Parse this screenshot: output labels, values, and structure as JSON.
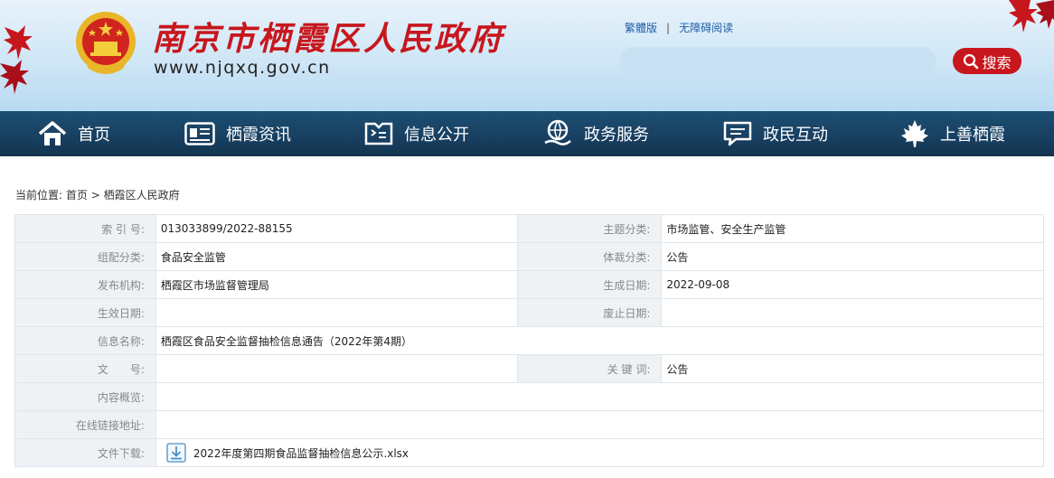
{
  "header": {
    "site_title": "南京市栖霞区人民政府",
    "site_url": "www.njqxq.gov.cn",
    "traditional_link": "繁體版",
    "separator": "|",
    "accessible_link": "无障碍阅读",
    "search_placeholder": "",
    "search_button": "搜索"
  },
  "nav": [
    {
      "label": "首页",
      "icon": "home-icon"
    },
    {
      "label": "栖霞资讯",
      "icon": "news-icon"
    },
    {
      "label": "信息公开",
      "icon": "document-icon"
    },
    {
      "label": "政务服务",
      "icon": "service-icon"
    },
    {
      "label": "政民互动",
      "icon": "chat-icon"
    },
    {
      "label": "上善栖霞",
      "icon": "maple-leaf-icon"
    }
  ],
  "breadcrumb": {
    "prefix": "当前位置:",
    "home": "首页",
    "sep": ">",
    "current": "栖霞区人民政府"
  },
  "info": {
    "index_label": "索 引 号:",
    "index_value": "013033899/2022-88155",
    "topic_label": "主题分类:",
    "topic_value": "市场监管、安全生产监管",
    "org_label": "组配分类:",
    "org_value": "食品安全监管",
    "genre_label": "体裁分类:",
    "genre_value": "公告",
    "publisher_label": "发布机构:",
    "publisher_value": "栖霞区市场监督管理局",
    "created_label": "生成日期:",
    "created_value": "2022-09-08",
    "effective_label": "生效日期:",
    "effective_value": "",
    "expire_label": "废止日期:",
    "expire_value": "",
    "name_label": "信息名称:",
    "name_value": "栖霞区食品安全监督抽检信息通告（2022年第4期）",
    "docno_label": "文　　号:",
    "docno_value": "",
    "keyword_label": "关 键 词:",
    "keyword_value": "公告",
    "summary_label": "内容概览:",
    "summary_value": "",
    "link_label": "在线链接地址:",
    "link_value": "",
    "download_label": "文件下载:",
    "download_file": "2022年度第四期食品监督抽检信息公示.xlsx"
  },
  "colors": {
    "brand_red": "#c8161d",
    "nav_bg": "#183f60",
    "label_bg": "#eef2f5"
  }
}
